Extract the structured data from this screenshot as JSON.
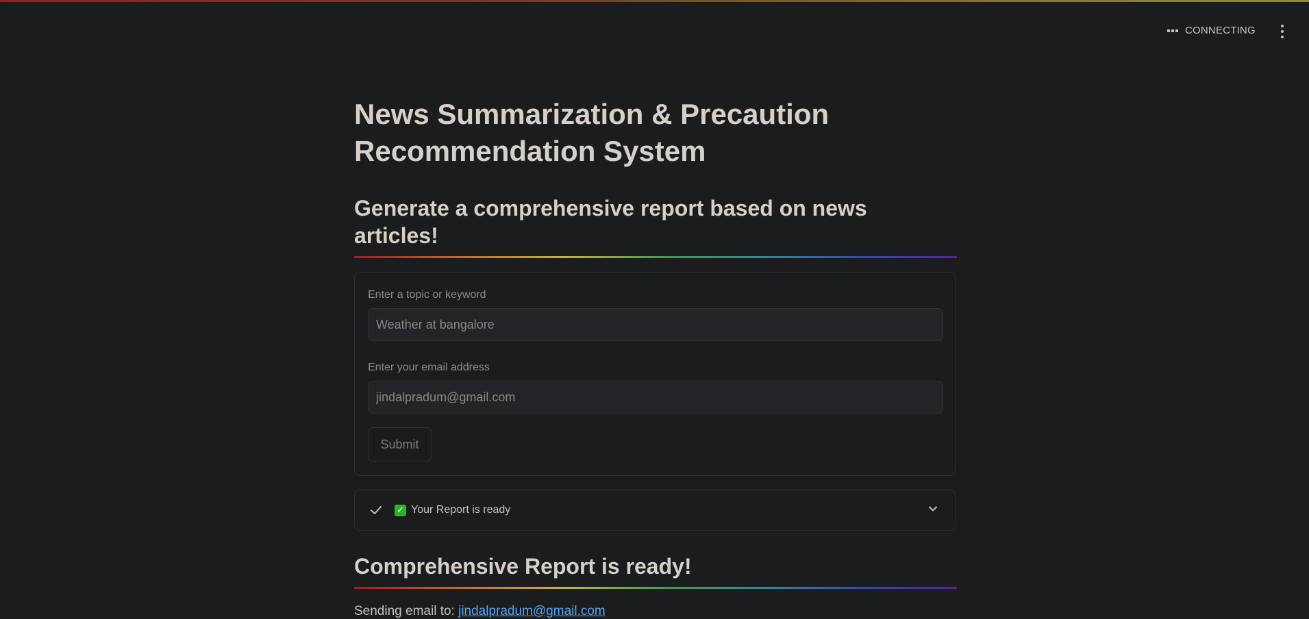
{
  "header": {
    "status_text": "CONNECTING",
    "status_icon": "connecting-dots-icon",
    "menu_icon": "kebab-menu-icon"
  },
  "main": {
    "title": "News Summarization & Precaution Recommendation System",
    "subtitle": "Generate a comprehensive report based on news articles!",
    "form": {
      "topic_label": "Enter a topic or keyword",
      "topic_value": "Weather at bangalore",
      "email_label": "Enter your email address",
      "email_value": "jindalpradum@gmail.com",
      "submit_label": "Submit"
    },
    "expander": {
      "label": "Your Report is ready",
      "status_icon": "check-icon",
      "emoji": "✓",
      "chevron": "chevron-down-icon"
    },
    "report_heading": "Comprehensive Report is ready!",
    "sending_prefix": "Sending email to:",
    "sending_email": "jindalpradum@gmail.com"
  },
  "colors": {
    "background": "#1b1c1e",
    "text": "#c8c3bc",
    "link": "#55a6f5",
    "success_green": "#2eb12e"
  }
}
